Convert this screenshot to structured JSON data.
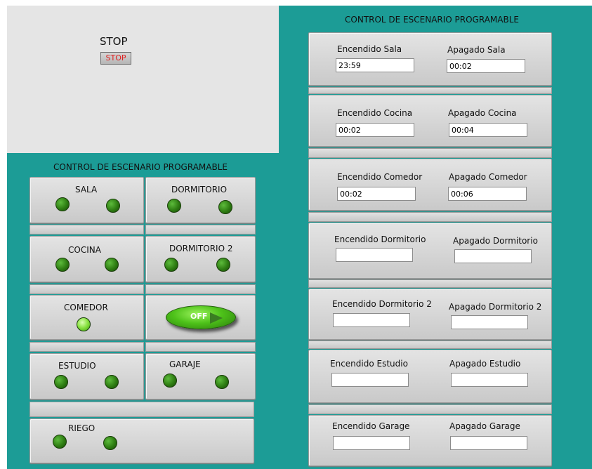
{
  "stop": {
    "label": "STOP",
    "button_text": "STOP"
  },
  "left_cluster": {
    "title": "CONTROL DE ESCENARIO PROGRAMABLE",
    "rooms": [
      {
        "label": "SALA",
        "leds": [
          "off",
          "off"
        ]
      },
      {
        "label": "DORMITORIO",
        "leds": [
          "off",
          "off"
        ]
      },
      {
        "label": "COCINA",
        "leds": [
          "off",
          "off"
        ]
      },
      {
        "label": "DORMITORIO 2",
        "leds": [
          "off",
          "off"
        ]
      },
      {
        "label": "COMEDOR",
        "leds": [
          "on"
        ]
      },
      {
        "label": "ESTUDIO",
        "leds": [
          "off",
          "off"
        ]
      },
      {
        "label": "GARAJE",
        "leds": [
          "off",
          "off"
        ]
      },
      {
        "label": "RIEGO",
        "leds": [
          "off",
          "off"
        ]
      }
    ],
    "toggle": {
      "text": "OFF",
      "state": "off"
    }
  },
  "right_cluster": {
    "title": "CONTROL DE ESCENARIO PROGRAMABLE",
    "rows": [
      {
        "on_label": "Encendido Sala",
        "on_value": "23:59",
        "off_label": "Apagado Sala",
        "off_value": "00:02"
      },
      {
        "on_label": "Encendido Cocina",
        "on_value": "00:02",
        "off_label": "Apagado Cocina",
        "off_value": "00:04"
      },
      {
        "on_label": "Encendido Comedor",
        "on_value": "00:02",
        "off_label": "Apagado Comedor",
        "off_value": "00:06"
      },
      {
        "on_label": "Encendido Dormitorio",
        "on_value": "",
        "off_label": "Apagado Dormitorio",
        "off_value": ""
      },
      {
        "on_label": "Encendido Dormitorio 2",
        "on_value": "",
        "off_label": "Apagado Dormitorio 2",
        "off_value": ""
      },
      {
        "on_label": "Encendido Estudio",
        "on_value": "",
        "off_label": "Apagado Estudio",
        "off_value": ""
      },
      {
        "on_label": "Encendido Garage",
        "on_value": "",
        "off_label": "Apagado  Garage",
        "off_value": ""
      }
    ]
  }
}
